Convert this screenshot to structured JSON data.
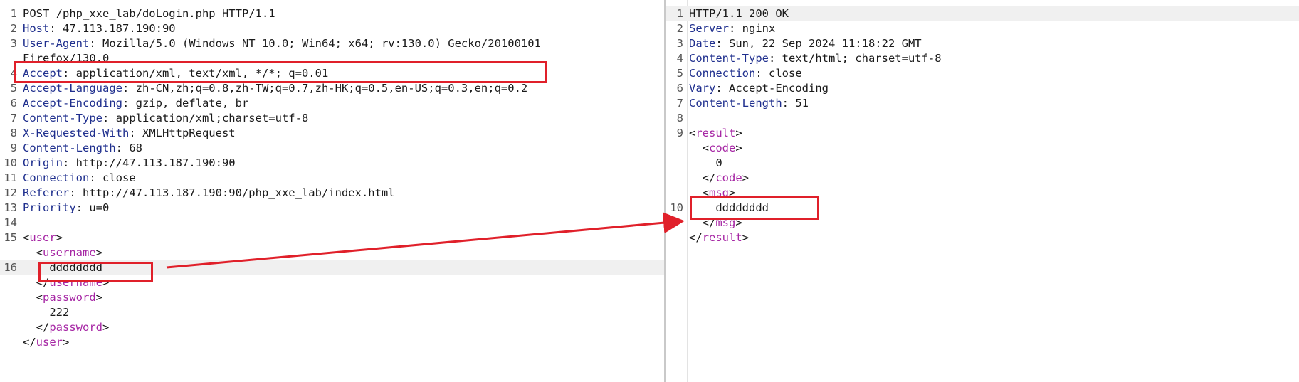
{
  "request": {
    "lines": [
      {
        "n": "1",
        "text": "POST /php_xxe_lab/doLogin.php HTTP/1.1"
      },
      {
        "n": "2",
        "key": "Host",
        "value": " 47.113.187.190:90"
      },
      {
        "n": "3",
        "key": "User-Agent",
        "value": " Mozilla/5.0 (Windows NT 10.0; Win64; x64; rv:130.0) Gecko/20100101"
      },
      {
        "n": "",
        "text": "Firefox/130.0"
      },
      {
        "n": "4",
        "key": "Accept",
        "value": " application/xml, text/xml, */*; q=0.01"
      },
      {
        "n": "5",
        "key": "Accept-Language",
        "value": " zh-CN,zh;q=0.8,zh-TW;q=0.7,zh-HK;q=0.5,en-US;q=0.3,en;q=0.2"
      },
      {
        "n": "6",
        "key": "Accept-Encoding",
        "value": " gzip, deflate, br"
      },
      {
        "n": "7",
        "key": "Content-Type",
        "value": " application/xml;charset=utf-8"
      },
      {
        "n": "8",
        "key": "X-Requested-With",
        "value": " XMLHttpRequest"
      },
      {
        "n": "9",
        "key": "Content-Length",
        "value": " 68"
      },
      {
        "n": "10",
        "key": "Origin",
        "value": " http://47.113.187.190:90"
      },
      {
        "n": "11",
        "key": "Connection",
        "value": " close"
      },
      {
        "n": "12",
        "key": "Referer",
        "value": " http://47.113.187.190:90/php_xxe_lab/index.html"
      },
      {
        "n": "13",
        "key": "Priority",
        "value": " u=0"
      },
      {
        "n": "14",
        "text": ""
      },
      {
        "n": "15",
        "open": "<",
        "tag": "user",
        "close": ">"
      },
      {
        "n": "",
        "indent": "  ",
        "open": "<",
        "tag": "username",
        "close": ">"
      },
      {
        "n": "16",
        "indent": "    ",
        "text": "dddddddd"
      },
      {
        "n": "",
        "indent": "  ",
        "open": "</",
        "tag": "username",
        "close": ">"
      },
      {
        "n": "",
        "indent": "  ",
        "open": "<",
        "tag": "password",
        "close": ">"
      },
      {
        "n": "",
        "indent": "    ",
        "text": "222"
      },
      {
        "n": "",
        "indent": "  ",
        "open": "</",
        "tag": "password",
        "close": ">"
      },
      {
        "n": "",
        "open": "</",
        "tag": "user",
        "close": ">"
      }
    ]
  },
  "response": {
    "lines": [
      {
        "n": "1",
        "text": "HTTP/1.1 200 OK"
      },
      {
        "n": "2",
        "key": "Server",
        "value": " nginx"
      },
      {
        "n": "3",
        "key": "Date",
        "value": " Sun, 22 Sep 2024 11:18:22 GMT"
      },
      {
        "n": "4",
        "key": "Content-Type",
        "value": " text/html; charset=utf-8"
      },
      {
        "n": "5",
        "key": "Connection",
        "value": " close"
      },
      {
        "n": "6",
        "key": "Vary",
        "value": " Accept-Encoding"
      },
      {
        "n": "7",
        "key": "Content-Length",
        "value": " 51"
      },
      {
        "n": "8",
        "text": ""
      },
      {
        "n": "9",
        "open": "<",
        "tag": "result",
        "close": ">"
      },
      {
        "n": "",
        "indent": "  ",
        "open": "<",
        "tag": "code",
        "close": ">"
      },
      {
        "n": "",
        "indent": "    ",
        "text": "0"
      },
      {
        "n": "",
        "indent": "  ",
        "open": "</",
        "tag": "code",
        "close": ">"
      },
      {
        "n": "",
        "indent": "  ",
        "open": "<",
        "tag": "msg",
        "close": ">"
      },
      {
        "n": "10",
        "indent": "    ",
        "text": "dddddddd"
      },
      {
        "n": "",
        "indent": "  ",
        "open": "</",
        "tag": "msg",
        "close": ">"
      },
      {
        "n": "",
        "open": "</",
        "tag": "result",
        "close": ">"
      }
    ]
  },
  "colors": {
    "header_key": "#1f2f8e",
    "xml_tag": "#a626a4",
    "annotation": "#e0202a",
    "tab_accent": "#e8743b"
  }
}
